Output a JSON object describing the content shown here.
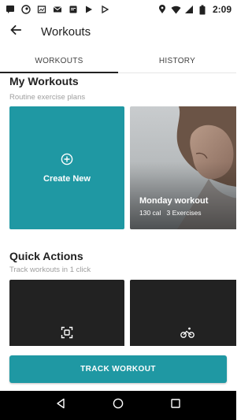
{
  "status_bar": {
    "time": "2:09",
    "icons": [
      "sms-icon",
      "steam-icon",
      "screenshot-icon",
      "gmail-icon",
      "notification-icon",
      "play-store-icon",
      "play-icon"
    ],
    "right_icons": [
      "location-icon",
      "wifi-icon",
      "signal-icon",
      "battery-icon"
    ]
  },
  "app_bar": {
    "title": "Workouts",
    "back_icon": "arrow-back-icon"
  },
  "tabs": [
    {
      "label": "WORKOUTS",
      "active": true
    },
    {
      "label": "HISTORY",
      "active": false
    }
  ],
  "my_workouts": {
    "title": "My Workouts",
    "subtitle": "Routine exercise plans",
    "create_label": "Create New",
    "workout_card": {
      "name": "Monday workout",
      "calories": "130 cal",
      "exercises": "3 Exercises"
    }
  },
  "quick_actions": {
    "title": "Quick Actions",
    "subtitle": "Track workouts in 1 click",
    "items": [
      {
        "icon": "scan-icon"
      },
      {
        "icon": "cycling-icon"
      }
    ]
  },
  "track_button": {
    "label": "TRACK WORKOUT"
  },
  "colors": {
    "accent": "#1f98a3",
    "dark_card": "#222222"
  }
}
